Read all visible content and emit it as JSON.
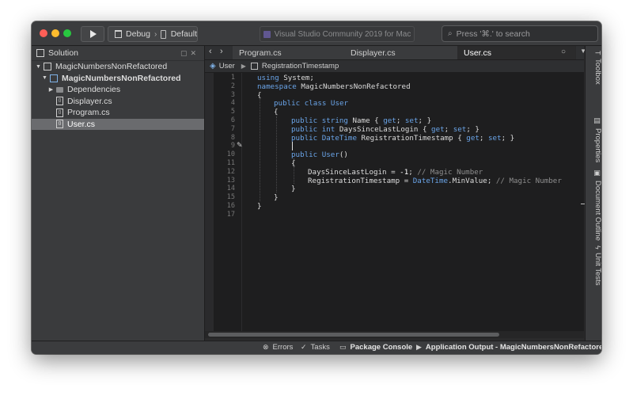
{
  "toolbar": {
    "config": "Debug",
    "config_chevron": "›",
    "device": "Default",
    "title": "Visual Studio Community 2019 for Mac",
    "search_placeholder": "Press '⌘.' to search",
    "icons": {
      "run": "play-icon",
      "search": "search-icon"
    }
  },
  "solution_pad": {
    "title": "Solution",
    "items": [
      {
        "label": "MagicNumbersNonRefactored",
        "type": "solution",
        "expanded": true
      },
      {
        "label": "MagicNumbersNonRefactored",
        "type": "project",
        "expanded": true
      },
      {
        "label": "Dependencies",
        "type": "folder",
        "expanded": false
      },
      {
        "label": "Displayer.cs",
        "type": "file"
      },
      {
        "label": "Program.cs",
        "type": "file"
      },
      {
        "label": "User.cs",
        "type": "file",
        "selected": true
      }
    ]
  },
  "tabs": [
    {
      "label": "Program.cs",
      "active": false
    },
    {
      "label": "Displayer.cs",
      "active": false
    },
    {
      "label": "User.cs",
      "active": true
    }
  ],
  "pathbar": {
    "class_name": "User",
    "member_name": "RegistrationTimestamp"
  },
  "editor": {
    "line_numbers": [
      "1",
      "2",
      "3",
      "4",
      "5",
      "6",
      "7",
      "8",
      "9",
      "10",
      "11",
      "12",
      "13",
      "14",
      "15",
      "16",
      "17"
    ],
    "code": {
      "l1_kw": "using",
      "l1_rest": " System;",
      "l2_kw": "namespace",
      "l2_rest": " MagicNumbersNonRefactored",
      "l3": "{",
      "l4_kw": "public class",
      "l4_type": " User",
      "l5": "{",
      "l6_kw1": "public",
      "l6_kw2": " string",
      "l6_a": " Name { ",
      "l6_get": "get",
      "l6_b": "; ",
      "l6_set": "set",
      "l6_c": "; }",
      "l7_kw1": "public",
      "l7_kw2": " int",
      "l7_a": " DaysSinceLastLogin { ",
      "l7_get": "get",
      "l7_b": "; ",
      "l7_set": "set",
      "l7_c": "; }",
      "l8_kw1": "public",
      "l8_kw2": " DateTime",
      "l8_a": " RegistrationTimestamp { ",
      "l8_get": "get",
      "l8_b": "; ",
      "l8_set": "set",
      "l8_c": "; }",
      "l10_kw": "public",
      "l10_type": " User",
      "l10_rest": "()",
      "l11": "{",
      "l12_a": "DaysSinceLastLogin = ",
      "l12_num": "-1",
      "l12_b": "; ",
      "l12_cm": "// Magic Number",
      "l13_a": "RegistrationTimestamp = ",
      "l13_type": "DateTime",
      "l13_b": ".MinValue; ",
      "l13_cm": "// Magic Number",
      "l14": "}",
      "l15": "}",
      "l16": "}"
    }
  },
  "dock": {
    "items": [
      "Toolbox",
      "Properties",
      "Document Outline",
      "Unit Tests"
    ]
  },
  "statusbar": {
    "errors": "Errors",
    "tasks": "Tasks",
    "package_console": "Package Console",
    "app_output": "Application Output - MagicNumbersNonRefactored"
  },
  "colors": {
    "keyword": "#6aa4e8",
    "comment": "#8e8e8e",
    "selection": "#6a6b6e",
    "editor_bg": "#1e1e1f"
  }
}
